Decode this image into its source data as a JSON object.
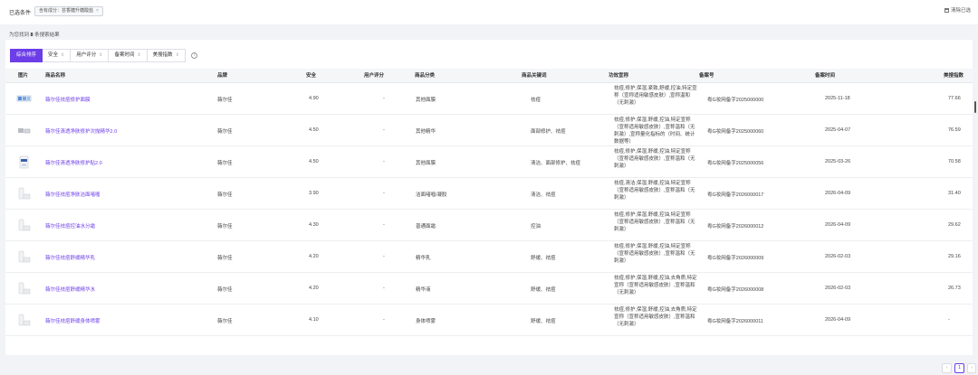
{
  "filter": {
    "label": "已选条件",
    "tag": "含有成分：芸香糖升糖酸盐",
    "tag_close": "×",
    "clear_label": "清除已选"
  },
  "result_prefix": "为您找到",
  "result_count": "8",
  "result_suffix": "条搜索结果",
  "sort_tabs": [
    {
      "label": "综合排序",
      "arrow": ""
    },
    {
      "label": "安全",
      "arrow": "⇕"
    },
    {
      "label": "用户评分",
      "arrow": "⇕"
    },
    {
      "label": "备案时间",
      "arrow": "⇕"
    },
    {
      "label": "美搜指数",
      "arrow": "⇕"
    }
  ],
  "help_icon": "?",
  "columns": [
    "图片",
    "商品名称",
    "品牌",
    "安全",
    "用户评分",
    "商品分类",
    "商品关键词",
    "功效宣称",
    "备案号",
    "备案时间",
    "美搜指数"
  ],
  "rows": [
    {
      "thumb": "blue",
      "name": "薇尔佳祛痘修护面膜",
      "brand": "薇尔佳",
      "safety": "4.90",
      "rating": "-",
      "category": "其他面膜",
      "keywords": "祛痘",
      "claim": "祛痘,修护,保湿,紧致,舒缓,控油,特定宣称（宣称适用敏感皮肤）,宣称温和（无刺激）",
      "record_no": "粤G妆网备字2025000000",
      "date": "2025-11-18",
      "index": "77.66"
    },
    {
      "thumb": "mask",
      "name": "薇尔佳清透净肤修护次抛精华2.0",
      "brand": "薇尔佳",
      "safety": "4.50",
      "rating": "-",
      "category": "其他精华",
      "keywords": "面部修护、祛痘",
      "claim": "祛痘,修护,保湿,舒缓,控油,特定宣称（宣称适用敏感皮肤）,宣称温和（无刺激）,宣称量化指标的（时间、统计数据等）",
      "record_no": "粤G妆网备字2025000060",
      "date": "2025-04-07",
      "index": "76.59"
    },
    {
      "thumb": "box",
      "name": "薇尔佳清透净肤修护贴2.0",
      "brand": "薇尔佳",
      "safety": "4.50",
      "rating": "-",
      "category": "其他面膜",
      "keywords": "清洁、面部修护、祛痘",
      "claim": "祛痘,修护,保湿,舒缓,控油,特定宣称（宣称适用敏感皮肤）,宣称温和（无刺激）",
      "record_no": "粤G妆网备字2025000056",
      "date": "2025-03-26",
      "index": "70.58"
    },
    {
      "thumb": "tube",
      "name": "薇尔佳祛痘净肤洁面啫喱",
      "brand": "薇尔佳",
      "safety": "3.90",
      "rating": "-",
      "category": "洁面啫喱/凝胶",
      "keywords": "清洁、祛痘",
      "claim": "祛痘,清洁,保湿,舒缓,控油,特定宣称（宣称适用敏感皮肤）,宣称温和（无刺激）",
      "record_no": "粤G妆网备字2026000017",
      "date": "2026-04-09",
      "index": "31.40"
    },
    {
      "thumb": "tube",
      "name": "薇尔佳祛痘控油水分霜",
      "brand": "薇尔佳",
      "safety": "4.30",
      "rating": "-",
      "category": "普通面霜",
      "keywords": "控油",
      "claim": "祛痘,修护,保湿,舒缓,控油,特定宣称（宣称适用敏感皮肤）,宣称温和（无刺激）",
      "record_no": "粤G妆网备字2026000012",
      "date": "2026-04-09",
      "index": "29.62"
    },
    {
      "thumb": "tube",
      "name": "薇尔佳祛痘舒缓精华乳",
      "brand": "薇尔佳",
      "safety": "4.20",
      "rating": "-",
      "category": "精华乳",
      "keywords": "舒缓、祛痘",
      "claim": "祛痘,修护,保湿,舒缓,控油,特定宣称（宣称适用敏感皮肤）,宣称温和（无刺激）",
      "record_no": "粤G妆网备字2026000009",
      "date": "2026-02-03",
      "index": "29.16"
    },
    {
      "thumb": "tube",
      "name": "薇尔佳祛痘舒缓精华水",
      "brand": "薇尔佳",
      "safety": "4.20",
      "rating": "-",
      "category": "精华液",
      "keywords": "舒缓、祛痘",
      "claim": "祛痘,修护,保湿,舒缓,控油,去角质,特定宣称（宣称适用敏感皮肤）,宣称温和（无刺激）",
      "record_no": "粤G妆网备字2026000008",
      "date": "2026-02-03",
      "index": "26.73"
    },
    {
      "thumb": "tube",
      "name": "薇尔佳祛痘舒缓身体喷雾",
      "brand": "薇尔佳",
      "safety": "4.10",
      "rating": "-",
      "category": "身体喷雾",
      "keywords": "舒缓、祛痘",
      "claim": "祛痘,修护,保湿,舒缓,控油,去角质,特定宣称（宣称适用敏感皮肤）,宣称温和（无刺激）",
      "record_no": "粤G妆网备字2026000011",
      "date": "2026-04-09",
      "index": "-"
    }
  ],
  "pagination": {
    "prev": "‹",
    "current": "1",
    "next": "›"
  }
}
